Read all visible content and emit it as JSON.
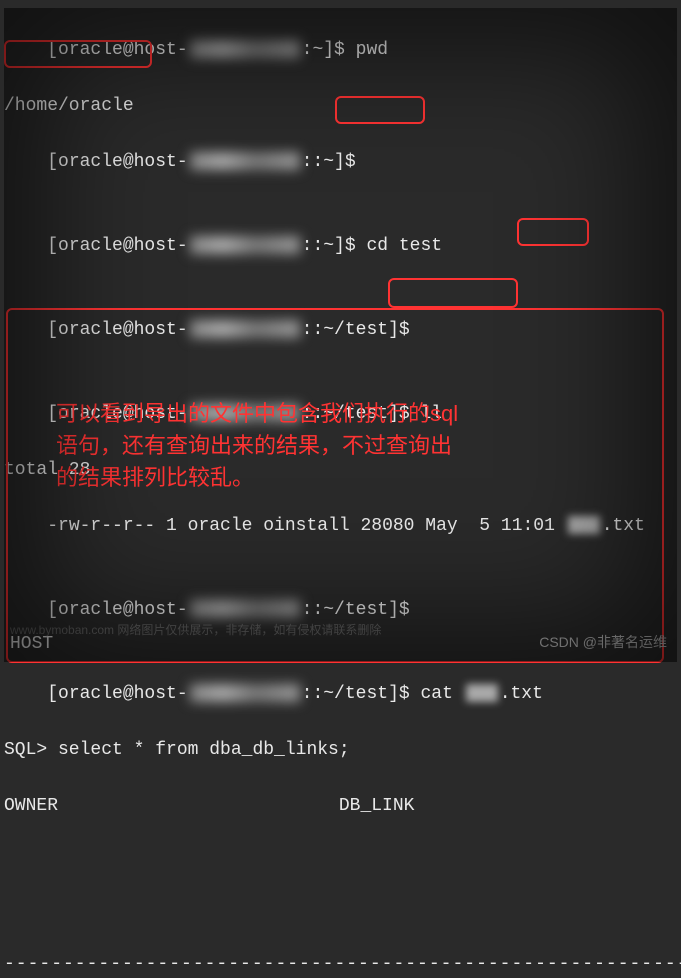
{
  "lines": {
    "l1_prefix": "[oracle@host-",
    "l1_suffix": ":~]$ pwd",
    "l2": "/home/oracle",
    "l3_prefix": "[oracle@host-",
    "l3_suffix": "::~]$",
    "l4_prefix": "[oracle@host-",
    "l4_suffix": "::~]$ ",
    "l4_cmd": "cd test",
    "l5_prefix": "[oracle@host-",
    "l5_suffix": "::~/test]$",
    "l6_prefix": "[oracle@host-",
    "l6_suffix": "::~/test]$ ll",
    "l7": "total 28",
    "l8_a": "-rw-r--r-- 1 oracle oinstall 28080 May  5 11:01 ",
    "l8_b": ".txt",
    "l9_prefix": "[oracle@host-",
    "l9_suffix": "::~/test]$",
    "l10_prefix": "[oracle@host-",
    "l10_suffix": "::~/test]$ cat ",
    "l10_b": ".txt",
    "l11": "SQL> select * from dba_db_links;",
    "l12": "OWNER                          DB_LINK",
    "l13": "-------------------------------------------------------------------",
    "host_bottom": "HOST"
  },
  "annotation": {
    "main": "可以看到导出的文件中包含我们执行的sql\n语句，还有查询出来的结果，不过查询出\n的结果排列比较乱。"
  },
  "watermark": {
    "right": "CSDN @非著名运维",
    "left": "www.bymoban.com 网络图片仅供展示，非存储，如有侵权请联系删除"
  }
}
